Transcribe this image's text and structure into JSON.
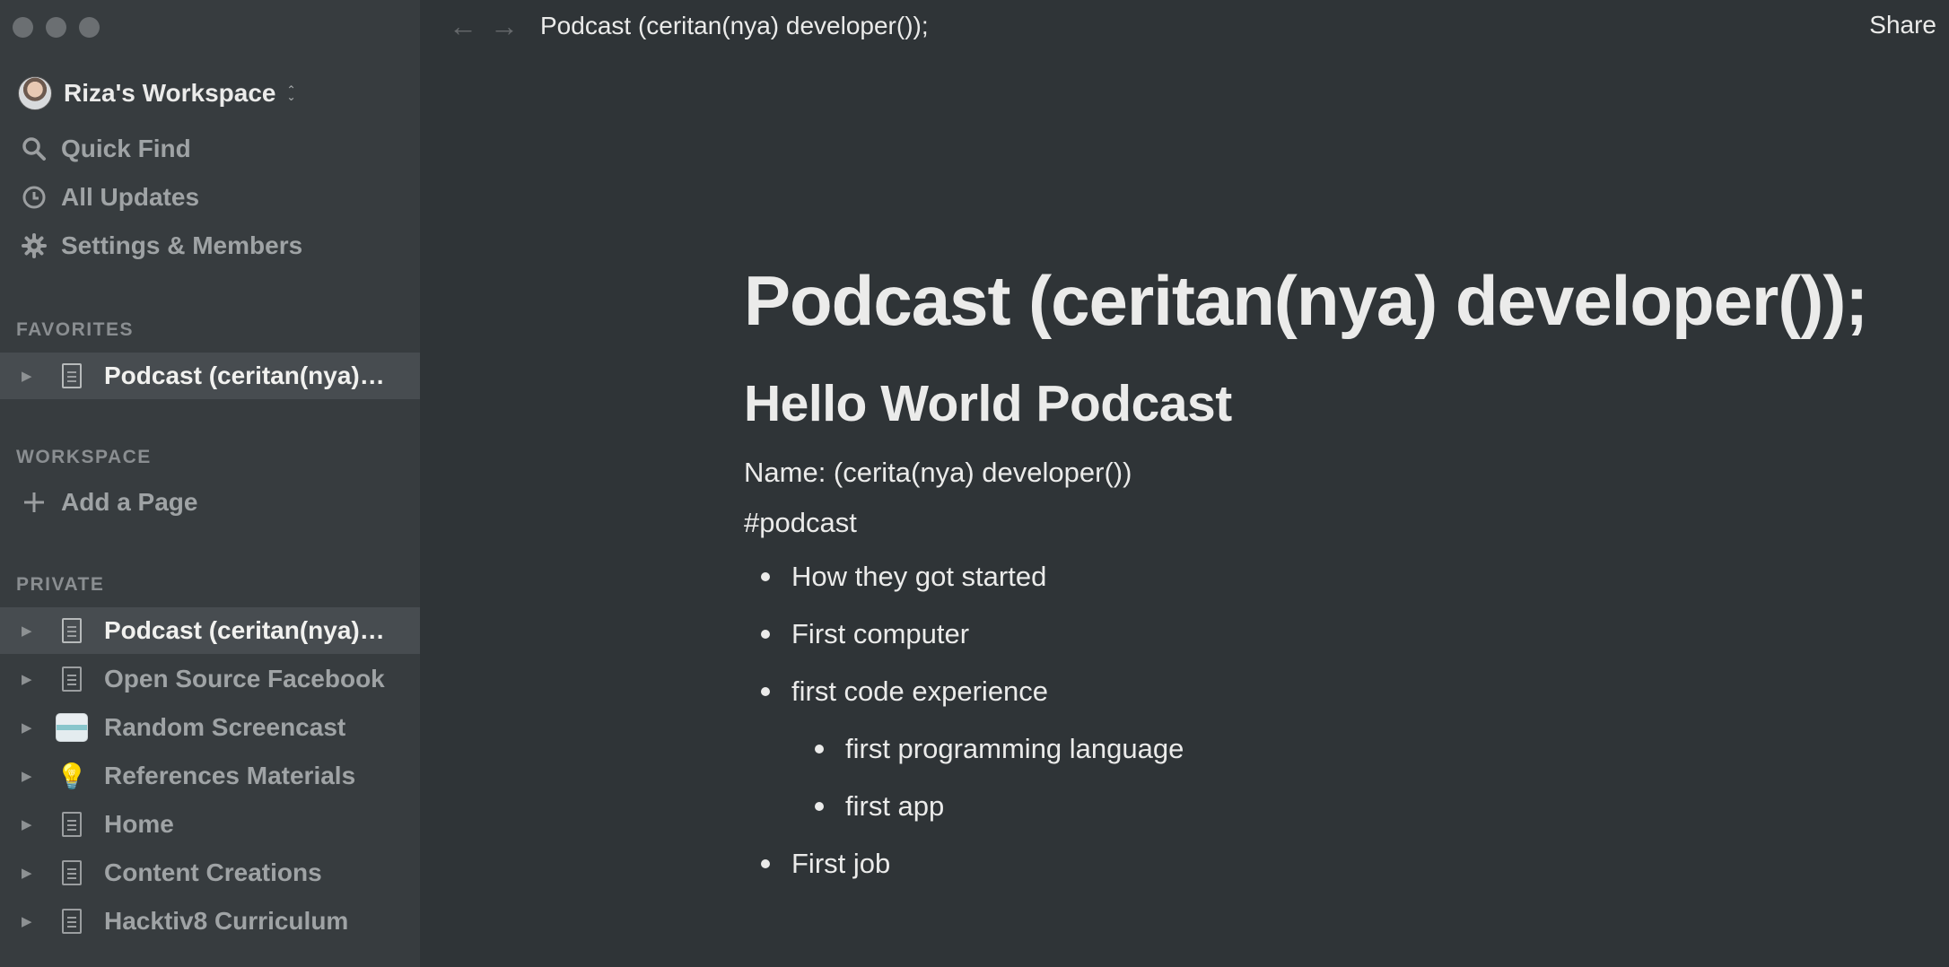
{
  "window": {
    "title": "Podcast (ceritan(nya) developer());"
  },
  "sidebar": {
    "workspace_name": "Riza's Workspace",
    "nav": [
      {
        "label": "Quick Find",
        "icon": "search-icon"
      },
      {
        "label": "All Updates",
        "icon": "clock-icon"
      },
      {
        "label": "Settings & Members",
        "icon": "gear-icon"
      }
    ],
    "favorites": {
      "label": "FAVORITES",
      "items": [
        {
          "label": "Podcast (ceritan(nya) developer());",
          "icon": "page-icon"
        }
      ]
    },
    "workspace": {
      "label": "WORKSPACE",
      "add_page": "Add a Page"
    },
    "private": {
      "label": "PRIVATE",
      "items": [
        {
          "label": "Podcast (ceritan(nya) developer());",
          "icon": "page-icon"
        },
        {
          "label": "Open Source Facebook",
          "icon": "page-icon"
        },
        {
          "label": "Random Screencast",
          "icon": "screencast-icon"
        },
        {
          "label": "References Materials",
          "icon": "lightbulb-icon"
        },
        {
          "label": "Home",
          "icon": "page-icon"
        },
        {
          "label": "Content Creations",
          "icon": "page-icon"
        },
        {
          "label": "Hacktiv8 Curriculum",
          "icon": "page-icon"
        }
      ]
    }
  },
  "topbar": {
    "breadcrumb": "Podcast (ceritan(nya) developer());",
    "share": "Share"
  },
  "page": {
    "title": "Podcast (ceritan(nya) developer());",
    "heading": "Hello World Podcast",
    "name_line": "Name: (cerita(nya) developer())",
    "tag": "#podcast",
    "bullets": [
      "How they got started",
      "First computer",
      "first code experience",
      "first programming language",
      "first app",
      "First job"
    ]
  }
}
